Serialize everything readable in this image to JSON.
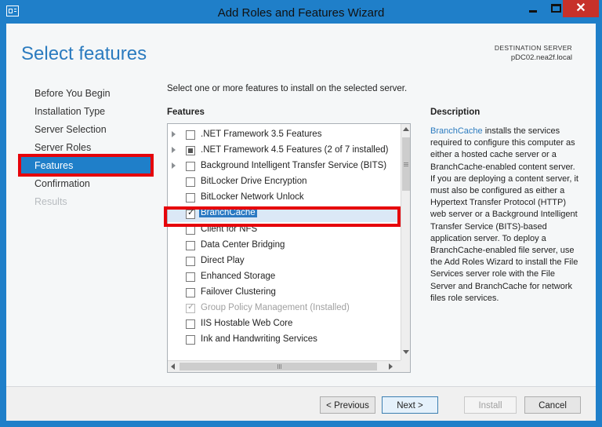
{
  "window": {
    "title": "Add Roles and Features Wizard",
    "close_glyph": "✕"
  },
  "header": {
    "page_title": "Select features",
    "destination_label": "DESTINATION SERVER",
    "destination_value": "pDC02.nea2f.local"
  },
  "nav": {
    "items": [
      {
        "label": "Before You Begin",
        "state": "normal"
      },
      {
        "label": "Installation Type",
        "state": "normal"
      },
      {
        "label": "Server Selection",
        "state": "normal"
      },
      {
        "label": "Server Roles",
        "state": "normal"
      },
      {
        "label": "Features",
        "state": "selected"
      },
      {
        "label": "Confirmation",
        "state": "normal"
      },
      {
        "label": "Results",
        "state": "disabled"
      }
    ]
  },
  "main": {
    "instruction": "Select one or more features to install on the selected server.",
    "features_header": "Features",
    "features": [
      {
        "label": ".NET Framework 3.5 Features",
        "expandable": true,
        "state": "unchecked"
      },
      {
        "label": ".NET Framework 4.5 Features (2 of 7 installed)",
        "expandable": true,
        "state": "partial"
      },
      {
        "label": "Background Intelligent Transfer Service (BITS)",
        "expandable": true,
        "state": "unchecked"
      },
      {
        "label": "BitLocker Drive Encryption",
        "expandable": false,
        "state": "unchecked"
      },
      {
        "label": "BitLocker Network Unlock",
        "expandable": false,
        "state": "unchecked"
      },
      {
        "label": "BranchCache",
        "expandable": false,
        "state": "checked",
        "selected": true
      },
      {
        "label": "Client for NFS",
        "expandable": false,
        "state": "unchecked"
      },
      {
        "label": "Data Center Bridging",
        "expandable": false,
        "state": "unchecked"
      },
      {
        "label": "Direct Play",
        "expandable": false,
        "state": "unchecked"
      },
      {
        "label": "Enhanced Storage",
        "expandable": false,
        "state": "unchecked"
      },
      {
        "label": "Failover Clustering",
        "expandable": false,
        "state": "unchecked"
      },
      {
        "label": "Group Policy Management (Installed)",
        "expandable": false,
        "state": "checked-disabled"
      },
      {
        "label": "IIS Hostable Web Core",
        "expandable": false,
        "state": "unchecked"
      },
      {
        "label": "Ink and Handwriting Services",
        "expandable": false,
        "state": "unchecked"
      }
    ],
    "check_glyph": "✓"
  },
  "description": {
    "header": "Description",
    "link_text": "BranchCache",
    "body": " installs the services required to configure this computer as either a hosted cache server or a BranchCache-enabled content server. If you are deploying a content server, it must also be configured as either a Hypertext Transfer Protocol (HTTP) web server or a Background Intelligent Transfer Service (BITS)-based application server. To deploy a BranchCache-enabled file server, use the Add Roles Wizard to install the File Services server role with the File Server and BranchCache for network files role services."
  },
  "footer": {
    "previous_label": "< Previous",
    "next_label": "Next >",
    "install_label": "Install",
    "cancel_label": "Cancel"
  },
  "colors": {
    "accent": "#1f7fc9",
    "highlight_annotation": "#e6040b",
    "selection": "#2b79c2",
    "close_button": "#c7312a"
  }
}
